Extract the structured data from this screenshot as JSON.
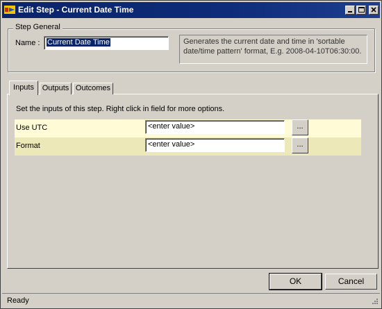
{
  "window": {
    "title": "Edit Step - Current Date Time",
    "controls": [
      "minimize-icon",
      "maximize-icon",
      "close-icon"
    ]
  },
  "step_general": {
    "legend": "Step General",
    "name_label": "Name :",
    "name_value": "Current Date Time",
    "description": "Generates the current date and time in 'sortable date/time pattern' format, E.g. 2008-04-10T06:30:00."
  },
  "tabs": [
    {
      "label": "Inputs",
      "active": true
    },
    {
      "label": "Outputs",
      "active": false
    },
    {
      "label": "Outcomes",
      "active": false
    }
  ],
  "inputs_tab": {
    "instructions": "Set the inputs of this step.  Right click in field for more options.",
    "params": [
      {
        "label": "Use UTC",
        "value": "<enter value>",
        "button": "..."
      },
      {
        "label": "Format",
        "value": "<enter value>",
        "button": "..."
      }
    ],
    "row_colors": [
      "#fffbd6",
      "#ece8b8"
    ]
  },
  "buttons": {
    "ok": "OK",
    "cancel": "Cancel"
  },
  "status": {
    "text": "Ready"
  },
  "colors": {
    "title_bar": "#0a246a",
    "dialog_face": "#d4d0c8"
  }
}
